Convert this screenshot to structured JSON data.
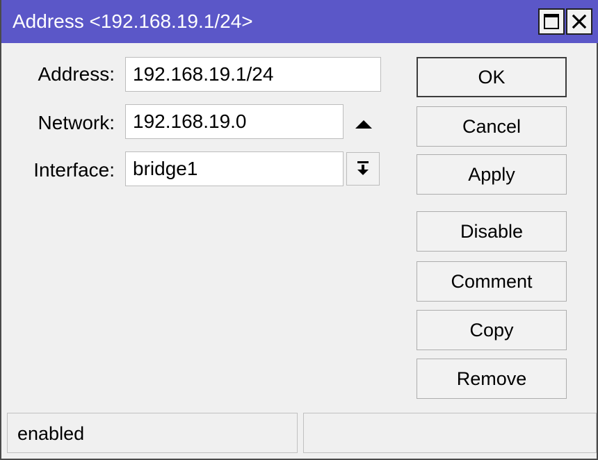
{
  "window": {
    "title": "Address <192.168.19.1/24>"
  },
  "form": {
    "address_label": "Address:",
    "address_value": "192.168.19.1/24",
    "network_label": "Network:",
    "network_value": "192.168.19.0",
    "interface_label": "Interface:",
    "interface_value": "bridge1"
  },
  "buttons": {
    "ok": "OK",
    "cancel": "Cancel",
    "apply": "Apply",
    "disable": "Disable",
    "comment": "Comment",
    "copy": "Copy",
    "remove": "Remove"
  },
  "status": {
    "left": "enabled",
    "right": ""
  },
  "icons": {
    "maximize": "maximize-icon",
    "close": "close-icon",
    "network_toggle": "arrow-up-icon",
    "interface_dropdown": "dropdown-arrow-icon"
  },
  "colors": {
    "titlebar": "#5b57c8",
    "background": "#f0f0f0"
  }
}
